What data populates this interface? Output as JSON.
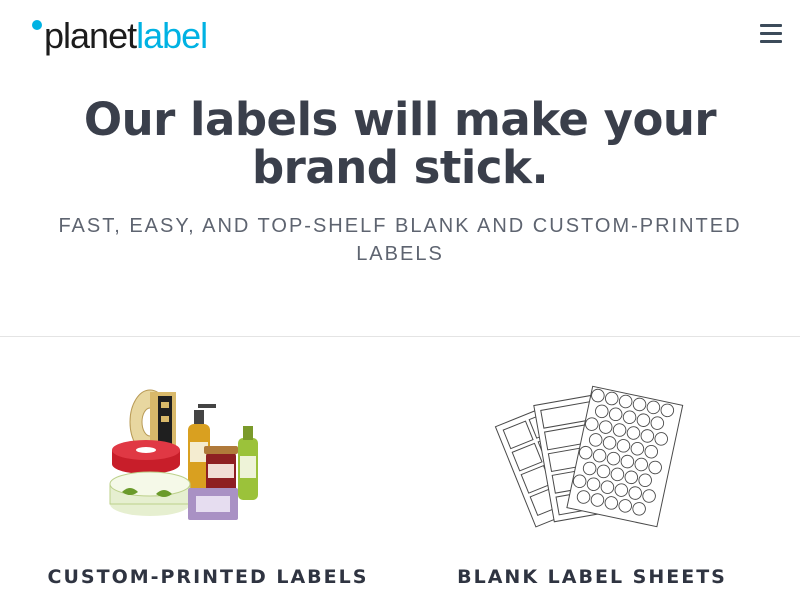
{
  "header": {
    "logo": {
      "part1": "planet",
      "part2": "label"
    },
    "menu_icon": "hamburger-menu-icon"
  },
  "hero": {
    "title": "Our labels will make your brand stick.",
    "subtitle": "FAST, EASY, AND TOP-SHELF BLANK AND CUSTOM-PRINTED LABELS"
  },
  "products": [
    {
      "title": "CUSTOM-PRINTED LABELS",
      "image": "custom-labels-products-image"
    },
    {
      "title": "BLANK LABEL SHEETS",
      "image": "blank-label-sheets-image"
    }
  ],
  "colors": {
    "brand_blue": "#00b2e3",
    "text_dark": "#3a3f4b",
    "text_muted": "#5e6470"
  }
}
